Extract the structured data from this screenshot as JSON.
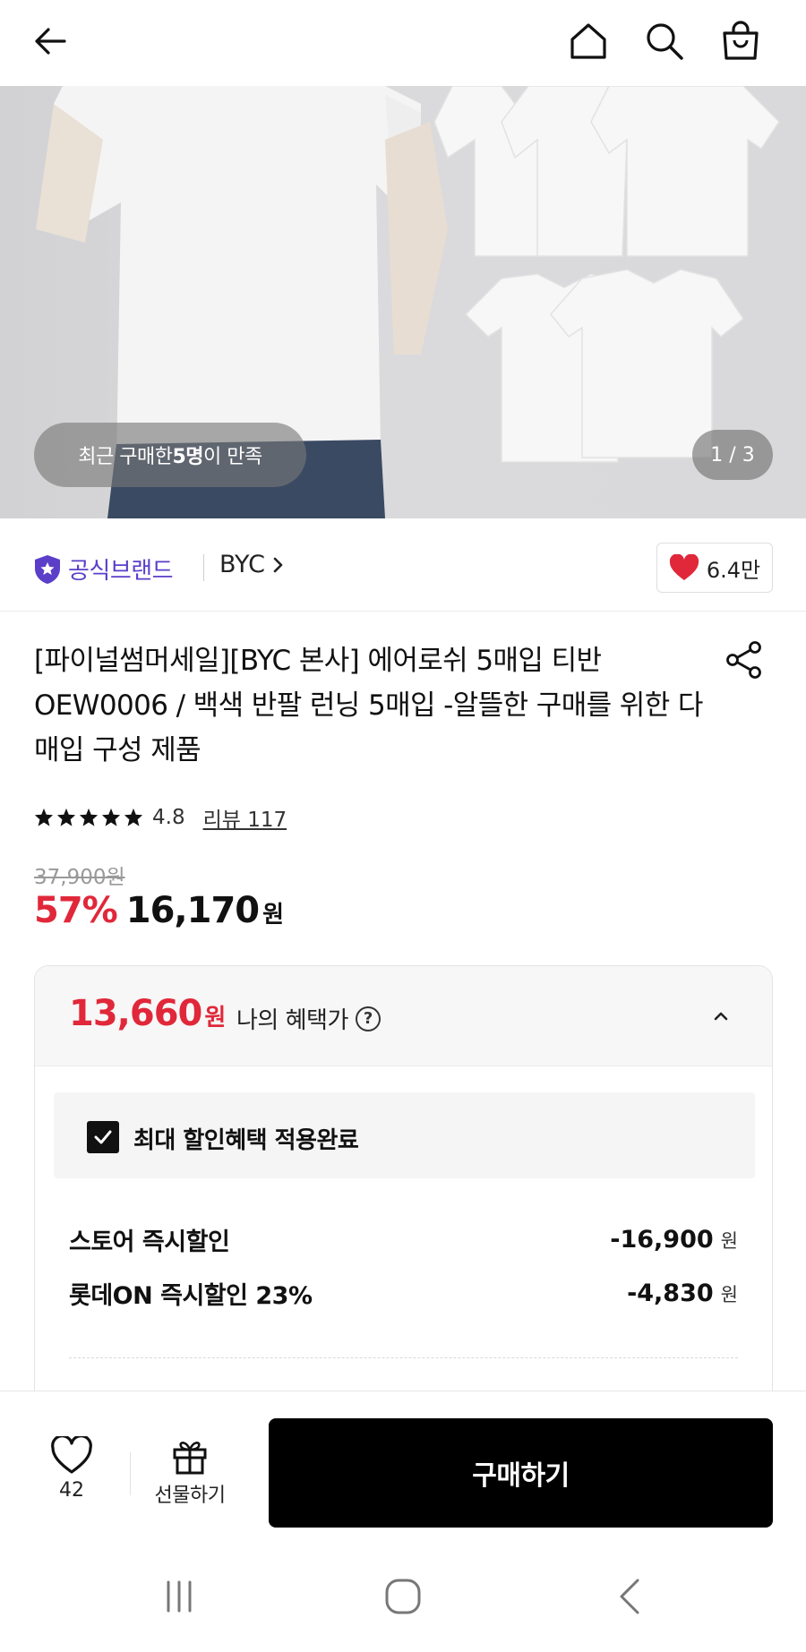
{
  "topbar": {
    "back_icon": "arrow-left-icon",
    "home_icon": "home-icon",
    "search_icon": "search-icon",
    "bag_icon": "shopping-bag-icon"
  },
  "hero": {
    "satisfy_prefix": "최근 구매한 ",
    "satisfy_bold": "5명",
    "satisfy_suffix": "이 만족",
    "page_indicator": "1 / 3",
    "current_page": 1,
    "total_pages": 3
  },
  "brand": {
    "official_label": "공식브랜드",
    "name": "BYC",
    "name_chevron": ">",
    "likes": "6.4만",
    "badge_color": "#5b3fc9",
    "heart_color": "#e0283a"
  },
  "product": {
    "title": "[파이널썸머세일][BYC 본사] 에어로쉬 5매입 티반 OEW0006 / 백색 반팔 런닝 5매입 -알뜰한 구매를 위한 다매입 구성 제품",
    "rating": "4.8",
    "rating_stars": 5,
    "review_label": "리뷰 117",
    "original_price": "37,900원",
    "discount_rate": "57%",
    "sale_price": "16,170",
    "sale_currency": "원"
  },
  "benefit": {
    "price": "13,660",
    "currency": "원",
    "label": "나의 혜택가",
    "help_icon": "question-circle-icon",
    "max_benefit_label": "최대 할인혜택 적용완료",
    "max_benefit_checked": true,
    "discounts": [
      {
        "label": "스토어 즉시할인",
        "amount": "-16,900",
        "unit": "원"
      },
      {
        "label": "롯데ON 즉시할인 23%",
        "amount": "-4,830",
        "unit": "원"
      }
    ]
  },
  "actions": {
    "wish_count": "42",
    "gift_label": "선물하기",
    "buy_label": "구매하기"
  },
  "colors": {
    "accent_red": "#e0283a",
    "brand_purple": "#5b3fc9",
    "buy_button": "#000000"
  }
}
